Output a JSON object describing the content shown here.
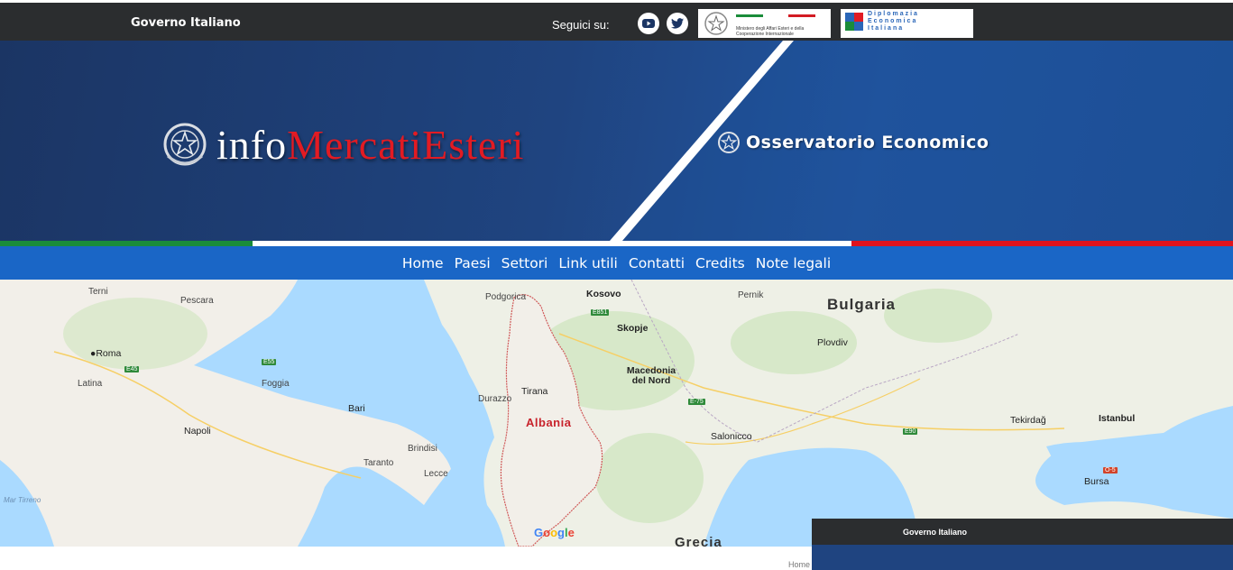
{
  "topbar": {
    "gov_label": "Governo Italiano",
    "follow_label": "Seguici su:",
    "maeci_text": "Ministero degli Affari Esteri e della Cooperazione Internazionale",
    "diplomazia_lines": [
      "Diplomazia",
      "Economica",
      "Italiana"
    ]
  },
  "hero": {
    "brand_info": "info",
    "brand_mercati": "MercatiEsteri",
    "observatory": "Osservatorio Economico"
  },
  "nav": {
    "items": [
      "Home",
      "Paesi",
      "Settori",
      "Link utili",
      "Contatti",
      "Credits",
      "Note legali"
    ]
  },
  "map": {
    "country_highlight": "Albania",
    "labels": {
      "bulgaria": "Bulgaria",
      "kosovo": "Kosovo",
      "skopje": "Skopje\nСкопје",
      "macedonia": "Macedonia del Nord",
      "tirana": "Tirana",
      "roma": "Roma",
      "napoli": "Napoli",
      "bari": "Bari",
      "foggia": "Foggia",
      "pescara": "Pescara",
      "latina": "Latina",
      "lecce": "Lecce",
      "taranto": "Taranto",
      "brindisi": "Brindisi",
      "salonicco": "Salonicco",
      "istanbul": "Istanbul",
      "bursa": "Bursa",
      "plovdiv": "Plovdiv",
      "tekirdag": "Tekirdağ",
      "podgorica": "Podgorica",
      "durazzo": "Durazzo",
      "pernik": "Pernik",
      "mar_tirreno": "Mar Tirreno",
      "grecia": "Grecia",
      "google": "Google"
    }
  },
  "breadcrumb": {
    "home": "Home"
  },
  "popup": {
    "gov_label": "Governo Italiano"
  }
}
